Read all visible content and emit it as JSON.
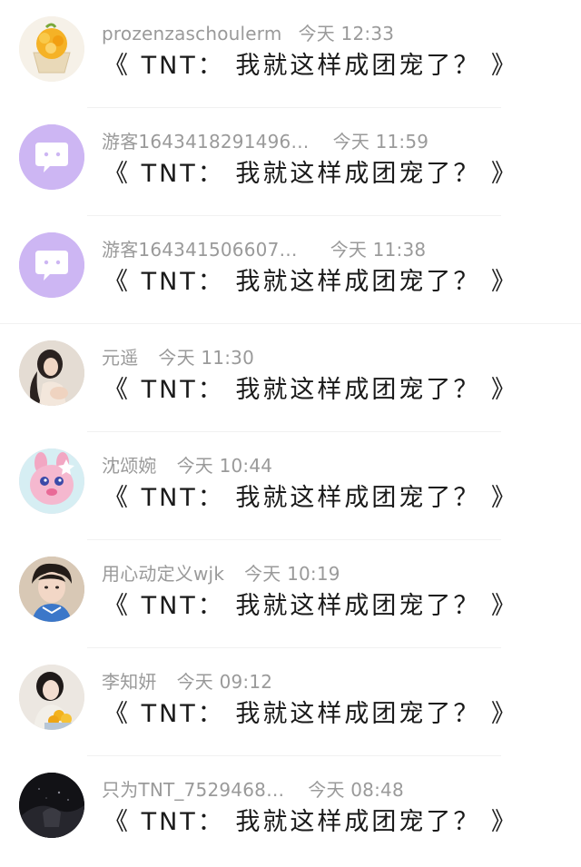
{
  "messages": [
    {
      "avatar": "avatar-cupcake",
      "name": "prozenzaschoulerm",
      "time": "今天 12:33",
      "text": "《 TNT： 我就这样成团宠了？ 》"
    },
    {
      "avatar": "avatar-guest-chat-icon",
      "name": "游客1643418291496…",
      "time": "今天 11:59",
      "text": "《 TNT： 我就这样成团宠了？ 》"
    },
    {
      "avatar": "avatar-guest-chat-icon",
      "name": "游客164341506607…",
      "time": "今天 11:38",
      "text": "《 TNT： 我就这样成团宠了？ 》"
    },
    {
      "avatar": "avatar-girl-photo",
      "name": "元遥",
      "time": "今天 11:30",
      "text": "《 TNT： 我就这样成团宠了？ 》"
    },
    {
      "avatar": "avatar-pink-toy",
      "name": "沈颂婉",
      "time": "今天 10:44",
      "text": "《 TNT： 我就这样成团宠了？ 》"
    },
    {
      "avatar": "avatar-boy-photo",
      "name": "用心动定义wjk",
      "time": "今天 10:19",
      "text": "《 TNT： 我就这样成团宠了？ 》"
    },
    {
      "avatar": "avatar-girl-oranges",
      "name": "李知妍",
      "time": "今天 09:12",
      "text": "《 TNT： 我就这样成团宠了？ 》"
    },
    {
      "avatar": "avatar-dark-photo",
      "name": "只为TNT_7529468…",
      "time": "今天 08:48",
      "text": "《 TNT： 我就这样成团宠了？ 》"
    }
  ],
  "colors": {
    "guest_avatar_bg": "#cdb6f3",
    "meta_text": "#9a9a9a",
    "message_text": "#1a1a1a"
  }
}
